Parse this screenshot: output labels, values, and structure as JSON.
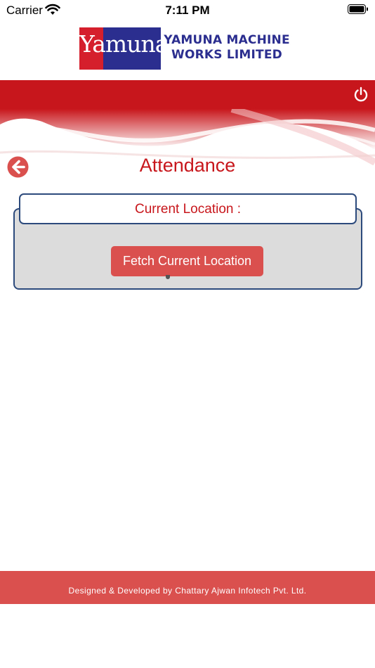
{
  "status_bar": {
    "carrier": "Carrier",
    "time": "7:11 PM",
    "wifi_icon": "wifi-icon",
    "battery_icon": "battery-icon"
  },
  "logo": {
    "brand_word": "Yamuna",
    "company_line1": "YAMUNA MACHINE",
    "company_line2": "WORKS LIMITED"
  },
  "header": {
    "power_icon": "power-icon",
    "bar_color": "#c8171c"
  },
  "page": {
    "back_icon": "back-arrow-icon",
    "title": "Attendance"
  },
  "location": {
    "label": "Current Location :",
    "button_label": "Fetch Current Location"
  },
  "footer": {
    "text": "Designed & Developed by Chattary Ajwan Infotech Pvt. Ltd."
  },
  "colors": {
    "accent_red": "#c8171c",
    "button_red": "#d9504f",
    "border_blue": "#2d4a7c",
    "panel_gray": "#dcdcdc",
    "logo_blue": "#2b2e8f"
  }
}
